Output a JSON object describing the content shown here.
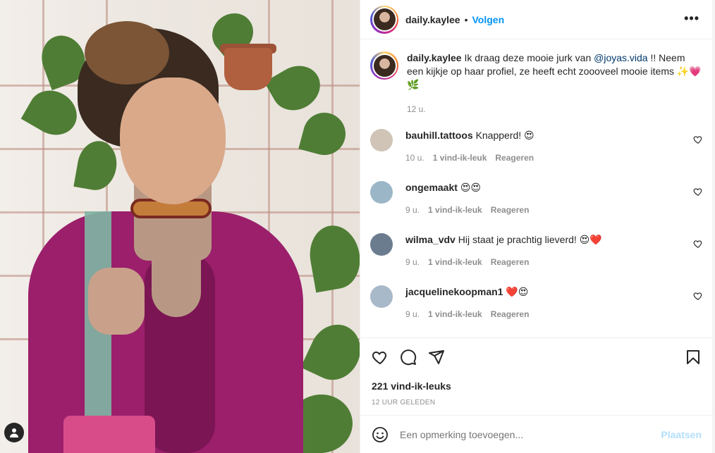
{
  "post": {
    "username": "daily.kaylee",
    "follow_label": "Volgen",
    "separator": "•",
    "more_icon": "more-horizontal-icon",
    "caption": {
      "username": "daily.kaylee",
      "text_before": " Ik draag deze mooie jurk van ",
      "mention": "@joyas.vida",
      "text_after": " !! Neem een kijkje op haar profiel, ze heeft echt zoooveel mooie items ✨💗🌿",
      "time": "12 u."
    },
    "comments": [
      {
        "username": "bauhill.tattoos",
        "text": "Knapperd! 😍",
        "time": "10 u.",
        "likes": "1 vind-ik-leuk",
        "reply": "Reageren",
        "avatar_color": "#cfc4b6"
      },
      {
        "username": "ongemaakt",
        "text": "😍😍",
        "time": "9 u.",
        "likes": "1 vind-ik-leuk",
        "reply": "Reageren",
        "avatar_color": "#9bb7c7"
      },
      {
        "username": "wilma_vdv",
        "text": "Hij staat je prachtig lieverd! 😍❤️",
        "time": "9 u.",
        "likes": "1 vind-ik-leuk",
        "reply": "Reageren",
        "avatar_color": "#6b7c8f"
      },
      {
        "username": "jacquelinekoopman1",
        "text": "❤️😍",
        "time": "9 u.",
        "likes": "1 vind-ik-leuk",
        "reply": "Reageren",
        "avatar_color": "#a8b9c9"
      }
    ],
    "likes_count": "221 vind-ik-leuks",
    "posted_ago": "12 UUR GELEDEN",
    "add_comment": {
      "placeholder": "Een opmerking toevoegen...",
      "post_label": "Plaatsen"
    },
    "colors": {
      "link": "#0095f6",
      "mention": "#00376b",
      "muted": "#8e8e8e",
      "post_disabled": "#b2dffc",
      "dress": "#9b1f6b"
    }
  }
}
